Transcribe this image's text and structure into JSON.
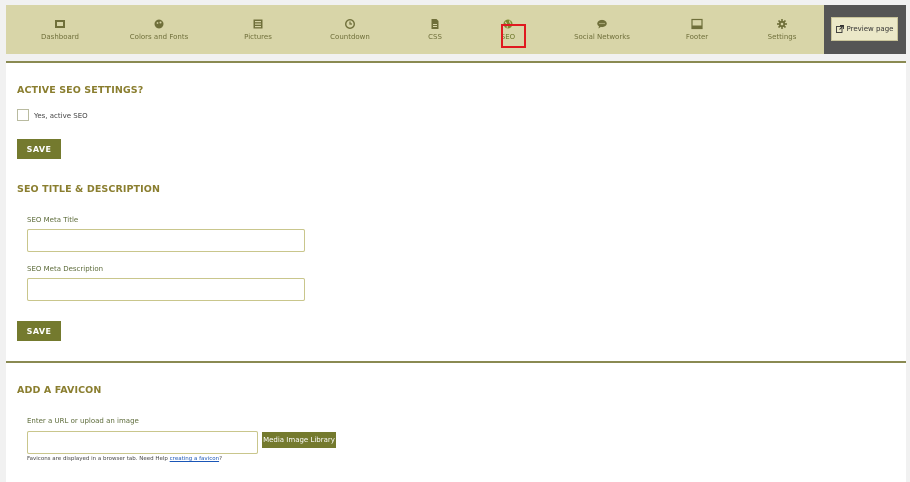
{
  "nav": {
    "items": [
      {
        "label": "Dashboard",
        "icon": "dashboard-icon"
      },
      {
        "label": "Colors and Fonts",
        "icon": "palette-icon"
      },
      {
        "label": "Pictures",
        "icon": "pictures-icon"
      },
      {
        "label": "Countdown",
        "icon": "clock-icon"
      },
      {
        "label": "CSS",
        "icon": "css-file-icon"
      },
      {
        "label": "SEO",
        "icon": "globe-icon"
      },
      {
        "label": "Social Networks",
        "icon": "chat-bubble-icon"
      },
      {
        "label": "Footer",
        "icon": "footer-icon"
      },
      {
        "label": "Settings",
        "icon": "gear-icon"
      }
    ],
    "active": "SEO",
    "highlight_color": "#e0191f"
  },
  "preview": {
    "label": "Preview page",
    "icon": "external-link-icon"
  },
  "seo_settings": {
    "title": "ACTIVE SEO SETTINGS?",
    "checkbox_label": "Yes, active SEO",
    "checked": false,
    "save_label": "SAVE"
  },
  "seo_title_desc": {
    "title": "SEO TITLE & DESCRIPTION",
    "meta_title_label": "SEO Meta Title",
    "meta_title_value": "",
    "meta_desc_label": "SEO Meta Description",
    "meta_desc_value": "",
    "save_label": "SAVE"
  },
  "favicon": {
    "title": "ADD A FAVICON",
    "url_label": "Enter a URL or upload an image",
    "url_value": "",
    "media_button_label": "Media Image Library",
    "help_text": "Favicons are displayed in a browser tab. Need Help",
    "help_link": "creating a favicon",
    "help_suffix": "?"
  },
  "colors": {
    "accent": "#747a2e",
    "topbar": "#d8d5a8",
    "title_text": "#8a7e2f"
  }
}
